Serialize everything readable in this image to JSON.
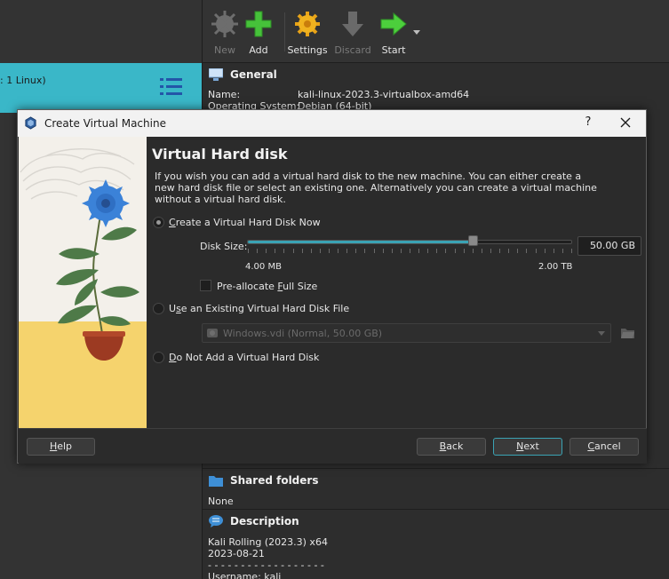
{
  "left_pane": {
    "vm_item_label": ": 1 Linux)"
  },
  "toolbar": {
    "new_label": "New",
    "add_label": "Add",
    "settings_label": "Settings",
    "discard_label": "Discard",
    "start_label": "Start"
  },
  "details": {
    "general": {
      "title": "General",
      "name_key": "Name:",
      "name_value": "kali-linux-2023.3-virtualbox-amd64",
      "os_key": "Operating System:",
      "os_value": "Debian (64-bit)"
    },
    "shared_folders": {
      "title": "Shared folders",
      "value": "None"
    },
    "description": {
      "title": "Description",
      "line1": "Kali Rolling (2023.3) x64",
      "line2": "2023-08-21",
      "line3": "- - - - - - - - - - - - - - - - - -",
      "line4": "Username: kali"
    }
  },
  "dialog": {
    "title": "Create Virtual Machine",
    "help_glyph": "?",
    "page_title": "Virtual Hard disk",
    "description": "If you wish you can add a virtual hard disk to the new machine. You can either create a new hard disk file or select an existing one. Alternatively you can create a virtual machine without a virtual hard disk.",
    "options": {
      "create_now": "Create a Virtual Hard Disk Now",
      "use_existing": "Use an Existing Virtual Hard Disk File",
      "do_not_add": "Do Not Add a Virtual Hard Disk"
    },
    "selected_option": "create_now",
    "disk_size": {
      "label": "Disk Size:",
      "value": "50.00 GB",
      "min_label": "4.00 MB",
      "max_label": "2.00 TB",
      "slider_fraction": 0.7
    },
    "preallocate_label": "Pre-allocate Full Size",
    "preallocate_checked": false,
    "existing_disk_value": "Windows.vdi (Normal, 50.00 GB)",
    "buttons": {
      "help": "Help",
      "back": "Back",
      "next": "Next",
      "cancel": "Cancel"
    }
  },
  "colors": {
    "accent": "#3aa3b4",
    "selected_vm": "#3ab7c8",
    "dialog_bg": "#2b2b2b",
    "titlebar_bg": "#f2f2f2"
  }
}
